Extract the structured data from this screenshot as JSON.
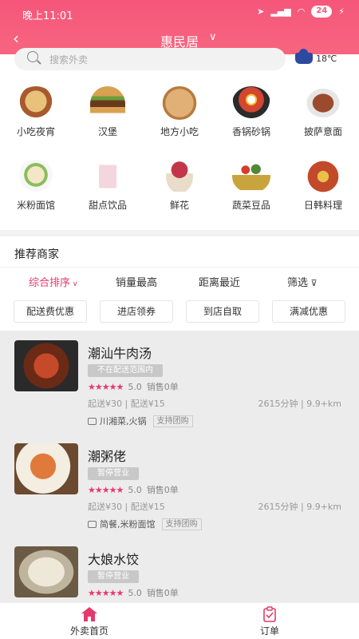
{
  "status": {
    "time": "晚上11:01",
    "battery": "24"
  },
  "nav": {
    "title": "惠民居"
  },
  "search": {
    "placeholder": "搜索外卖"
  },
  "weather": {
    "temp": "18℃"
  },
  "categories": [
    {
      "label": "小吃夜宵",
      "icon": "snack-icon",
      "color": "#d9a45a"
    },
    {
      "label": "汉堡",
      "icon": "burger-icon",
      "color": "#c8873f"
    },
    {
      "label": "地方小吃",
      "icon": "pancake-icon",
      "color": "#d6a268"
    },
    {
      "label": "香锅砂锅",
      "icon": "hotpot-icon",
      "color": "#3a3a3a"
    },
    {
      "label": "披萨意面",
      "icon": "steak-icon",
      "color": "#9b4a2e"
    },
    {
      "label": "米粉面馆",
      "icon": "noodle-bowl-icon",
      "color": "#a7c77a"
    },
    {
      "label": "甜点饮品",
      "icon": "drink-icon",
      "color": "#e8b6c4"
    },
    {
      "label": "鲜花",
      "icon": "flower-icon",
      "color": "#c4354a"
    },
    {
      "label": "蔬菜豆品",
      "icon": "vegetable-basket-icon",
      "color": "#c9a43d"
    },
    {
      "label": "日韩料理",
      "icon": "bento-icon",
      "color": "#c24a2a"
    }
  ],
  "section": {
    "title": "推荐商家"
  },
  "sort": {
    "comprehensive": "综合排序",
    "sales": "销量最高",
    "distance": "距离最近",
    "filter": "筛选"
  },
  "chips": [
    "配送费优惠",
    "进店领券",
    "到店自取",
    "满减优惠"
  ],
  "shops": [
    {
      "name": "潮汕牛肉汤",
      "tag": "不在配送范围内",
      "rating": "5.0",
      "sales": "销售0单",
      "delivery": "起送¥30 | 配送¥15",
      "distance": "2615分钟 | 9.9+km",
      "cuisine": "川湘菜,火锅",
      "group": "支持团购",
      "color": "#8a3a22"
    },
    {
      "name": "潮粥佬",
      "tag": "暂停营业",
      "rating": "5.0",
      "sales": "销售0单",
      "delivery": "起送¥30 | 配送¥15",
      "distance": "2615分钟 | 9.9+km",
      "cuisine": "简餐,米粉面馆",
      "group": "支持团购",
      "color": "#d9773f"
    },
    {
      "name": "大娘水饺",
      "tag": "暂停营业",
      "rating": "5.0",
      "sales": "销售0单",
      "delivery": "",
      "distance": "",
      "cuisine": "",
      "group": "",
      "color": "#d8d2c4"
    }
  ],
  "tabs": {
    "home": "外卖首页",
    "orders": "订单"
  }
}
